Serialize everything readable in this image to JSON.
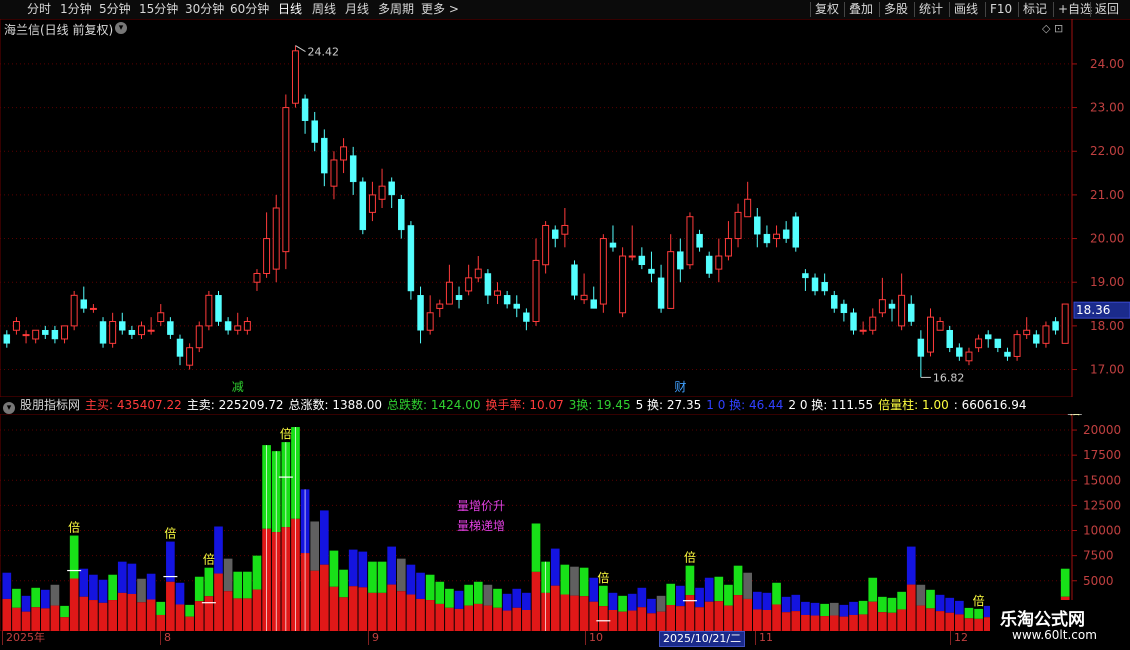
{
  "toolbar": {
    "left_items": [
      "分时",
      "1分钟",
      "5分钟",
      "15分钟",
      "30分钟",
      "60分钟",
      "日线",
      "周线",
      "月线",
      "多周期",
      "更多 >"
    ],
    "active": "日线",
    "right_items": [
      "复权",
      "叠加",
      "多股",
      "统计",
      "画线",
      "F10",
      "标记",
      "+自选",
      "返回"
    ]
  },
  "main_chart": {
    "title": "海兰信(日线 前复权)",
    "icons": [
      "◇",
      "⊡"
    ],
    "price_ticks": [
      "24.00",
      "23.00",
      "22.00",
      "21.00",
      "20.00",
      "19.00",
      "18.00",
      "17.00"
    ],
    "last_price": "18.36",
    "high_label": "24.42",
    "low_label": "16.82",
    "markers": [
      {
        "text": "减",
        "color": "#30d030"
      },
      {
        "text": "财",
        "color": "#40a0ff"
      }
    ]
  },
  "indicator": {
    "name": "股朋指标网",
    "fields": [
      {
        "text": "主买: 435407.22",
        "color": "#ff3b3b"
      },
      {
        "text": "主卖: 225209.72",
        "color": "#ffffff"
      },
      {
        "text": "总涨数: 1388.00",
        "color": "#ffffff"
      },
      {
        "text": "总跌数: 1424.00",
        "color": "#30d030"
      },
      {
        "text": "换手率: 10.07",
        "color": "#ff3b3b"
      },
      {
        "text": "3换: 19.45",
        "color": "#30d030"
      },
      {
        "text": "5 换: 27.35",
        "color": "#ffffff"
      },
      {
        "text": "1 0 换: 46.44",
        "color": "#3040ff"
      },
      {
        "text": "2 0 换: 111.55",
        "color": "#ffffff"
      },
      {
        "text": "倍量柱: 1.00",
        "color": "#ffff40"
      },
      {
        "text": ": 660616.94",
        "color": "#ffffff"
      }
    ],
    "vol_ticks": [
      "20000",
      "17500",
      "15000",
      "12500",
      "10000",
      "7500",
      "5000"
    ],
    "annotations": [
      "量增价升",
      "量梯递增"
    ],
    "bei_label": "倍"
  },
  "dates": [
    "2025年",
    "8",
    "9",
    "10",
    "2025/10/21/二",
    "11",
    "12"
  ],
  "watermark": {
    "title": "乐淘公式网",
    "url": "www.60lt.com"
  },
  "chart_data": {
    "type": "candlestick",
    "ylim": [
      16.6,
      24.8
    ],
    "vol_ylim": [
      0,
      21000
    ],
    "candles": [
      [
        17.8,
        17.6,
        17.9,
        17.5
      ],
      [
        17.9,
        18.1,
        18.2,
        17.8
      ],
      [
        17.8,
        17.8,
        17.9,
        17.6
      ],
      [
        17.7,
        17.9,
        17.9,
        17.6
      ],
      [
        17.9,
        17.8,
        18.0,
        17.7
      ],
      [
        17.9,
        17.7,
        18.0,
        17.6
      ],
      [
        17.7,
        18.0,
        18.0,
        17.6
      ],
      [
        18.0,
        18.7,
        18.8,
        17.9
      ],
      [
        18.6,
        18.4,
        18.9,
        18.3
      ],
      [
        18.4,
        18.4,
        18.5,
        18.3
      ],
      [
        18.1,
        17.6,
        18.2,
        17.5
      ],
      [
        17.6,
        18.1,
        18.3,
        17.5
      ],
      [
        18.1,
        17.9,
        18.3,
        17.8
      ],
      [
        17.9,
        17.8,
        18.0,
        17.7
      ],
      [
        17.8,
        18.0,
        18.1,
        17.7
      ],
      [
        17.9,
        17.9,
        18.2,
        17.8
      ],
      [
        18.1,
        18.3,
        18.5,
        18.0
      ],
      [
        18.1,
        17.8,
        18.2,
        17.7
      ],
      [
        17.7,
        17.3,
        17.8,
        17.1
      ],
      [
        17.1,
        17.5,
        17.6,
        17.0
      ],
      [
        17.5,
        18.0,
        18.1,
        17.4
      ],
      [
        18.0,
        18.7,
        18.8,
        17.9
      ],
      [
        18.7,
        18.1,
        18.8,
        18.0
      ],
      [
        18.1,
        17.9,
        18.2,
        17.8
      ],
      [
        17.9,
        18.0,
        18.3,
        17.8
      ],
      [
        17.9,
        18.1,
        18.2,
        17.8
      ],
      [
        19.0,
        19.2,
        19.3,
        18.8
      ],
      [
        19.2,
        20.0,
        20.6,
        19.1
      ],
      [
        19.3,
        20.7,
        21.0,
        19.0
      ],
      [
        19.7,
        23.0,
        23.3,
        19.3
      ],
      [
        23.1,
        24.3,
        24.42,
        23.0
      ],
      [
        23.2,
        22.7,
        23.3,
        22.4
      ],
      [
        22.7,
        22.2,
        22.9,
        22.0
      ],
      [
        22.3,
        21.5,
        22.5,
        21.2
      ],
      [
        21.2,
        21.8,
        22.0,
        20.9
      ],
      [
        21.8,
        22.1,
        22.3,
        21.5
      ],
      [
        21.9,
        21.3,
        22.1,
        21.0
      ],
      [
        21.3,
        20.2,
        21.4,
        20.1
      ],
      [
        20.6,
        21.0,
        21.3,
        20.4
      ],
      [
        20.9,
        21.2,
        21.6,
        20.7
      ],
      [
        21.3,
        21.0,
        21.4,
        20.7
      ],
      [
        20.9,
        20.2,
        21.0,
        20.0
      ],
      [
        20.3,
        18.8,
        20.4,
        18.6
      ],
      [
        18.7,
        17.9,
        18.9,
        17.6
      ],
      [
        17.9,
        18.3,
        18.7,
        17.8
      ],
      [
        18.4,
        18.5,
        18.6,
        18.2
      ],
      [
        18.5,
        19.0,
        19.4,
        18.5
      ],
      [
        18.7,
        18.6,
        18.9,
        18.4
      ],
      [
        18.8,
        19.1,
        19.4,
        18.7
      ],
      [
        19.1,
        19.3,
        19.6,
        19.0
      ],
      [
        19.2,
        18.7,
        19.3,
        18.5
      ],
      [
        18.7,
        18.8,
        19.0,
        18.5
      ],
      [
        18.7,
        18.5,
        18.8,
        18.4
      ],
      [
        18.5,
        18.4,
        18.7,
        18.2
      ],
      [
        18.3,
        18.1,
        18.4,
        17.9
      ],
      [
        18.1,
        19.5,
        20.0,
        18.0
      ],
      [
        19.4,
        20.3,
        20.4,
        19.2
      ],
      [
        20.2,
        20.0,
        20.3,
        19.8
      ],
      [
        20.1,
        20.3,
        20.7,
        19.8
      ],
      [
        19.4,
        18.7,
        19.5,
        18.6
      ],
      [
        18.6,
        18.7,
        19.2,
        18.5
      ],
      [
        18.6,
        18.4,
        18.9,
        18.4
      ],
      [
        18.5,
        20.0,
        20.1,
        18.3
      ],
      [
        19.9,
        19.8,
        20.3,
        19.7
      ],
      [
        18.3,
        19.6,
        19.8,
        18.2
      ],
      [
        19.6,
        19.6,
        20.3,
        19.5
      ],
      [
        19.6,
        19.4,
        19.8,
        19.3
      ],
      [
        19.3,
        19.2,
        19.7,
        19.0
      ],
      [
        19.1,
        18.4,
        19.4,
        18.3
      ],
      [
        18.4,
        19.7,
        20.1,
        18.5
      ],
      [
        19.7,
        19.3,
        20.0,
        19.0
      ],
      [
        19.4,
        20.5,
        20.6,
        19.3
      ],
      [
        20.1,
        19.8,
        20.2,
        19.7
      ],
      [
        19.6,
        19.2,
        19.7,
        19.1
      ],
      [
        19.3,
        19.6,
        20.0,
        19.0
      ],
      [
        19.6,
        20.0,
        20.4,
        19.5
      ],
      [
        20.0,
        20.6,
        20.8,
        19.8
      ],
      [
        20.5,
        20.9,
        21.3,
        20.5
      ],
      [
        20.5,
        20.1,
        20.7,
        19.8
      ],
      [
        20.1,
        19.9,
        20.3,
        19.8
      ],
      [
        20.0,
        20.1,
        20.3,
        19.8
      ],
      [
        20.2,
        20.0,
        20.4,
        19.9
      ],
      [
        20.5,
        19.8,
        20.6,
        19.7
      ],
      [
        19.2,
        19.1,
        19.3,
        18.8
      ],
      [
        19.1,
        18.8,
        19.2,
        18.7
      ],
      [
        19.0,
        18.8,
        19.2,
        18.7
      ],
      [
        18.7,
        18.4,
        18.8,
        18.3
      ],
      [
        18.5,
        18.3,
        18.6,
        18.1
      ],
      [
        18.3,
        17.9,
        18.4,
        17.8
      ],
      [
        17.9,
        17.9,
        18.1,
        17.8
      ],
      [
        17.9,
        18.2,
        18.4,
        17.8
      ],
      [
        18.3,
        18.6,
        19.1,
        18.2
      ],
      [
        18.5,
        18.4,
        18.6,
        18.1
      ],
      [
        18.0,
        18.7,
        19.2,
        17.9
      ],
      [
        18.5,
        18.1,
        18.7,
        18.0
      ],
      [
        17.7,
        17.3,
        17.9,
        16.82
      ],
      [
        17.4,
        18.2,
        18.4,
        17.3
      ],
      [
        17.9,
        18.1,
        18.2,
        17.9
      ],
      [
        17.9,
        17.5,
        18.0,
        17.4
      ],
      [
        17.5,
        17.3,
        17.6,
        17.2
      ],
      [
        17.2,
        17.4,
        17.5,
        17.1
      ],
      [
        17.5,
        17.7,
        17.8,
        17.4
      ],
      [
        17.8,
        17.7,
        17.9,
        17.5
      ],
      [
        17.7,
        17.5,
        17.7,
        17.4
      ],
      [
        17.4,
        17.3,
        17.5,
        17.2
      ],
      [
        17.3,
        17.8,
        17.9,
        17.2
      ],
      [
        17.8,
        17.9,
        18.2,
        17.7
      ],
      [
        17.8,
        17.6,
        17.9,
        17.5
      ],
      [
        17.6,
        18.0,
        18.1,
        17.5
      ],
      [
        18.1,
        17.9,
        18.2,
        17.8
      ],
      [
        17.6,
        18.5,
        18.5,
        17.6
      ]
    ],
    "volume": [
      5800,
      4200,
      3500,
      4300,
      4100,
      4600,
      2500,
      9500,
      6200,
      5600,
      5100,
      5600,
      6900,
      6700,
      5200,
      5700,
      2900,
      8900,
      4800,
      2600,
      5400,
      6300,
      10400,
      7200,
      5900,
      5900,
      7500,
      18500,
      17900,
      18800,
      20300,
      14100,
      10900,
      12000,
      8000,
      6100,
      8100,
      7900,
      6900,
      6900,
      8400,
      7200,
      6600,
      5800,
      5600,
      4900,
      4200,
      4000,
      4600,
      4900,
      4600,
      4200,
      3700,
      4200,
      3800,
      10700,
      6900,
      8200,
      6600,
      6400,
      6300,
      5300,
      4500,
      3800,
      3500,
      3700,
      4300,
      3200,
      3500,
      4700,
      4500,
      6500,
      4300,
      5300,
      5400,
      4600,
      6500,
      5800,
      3900,
      3800,
      4800,
      3400,
      3600,
      2900,
      2800,
      2700,
      2800,
      2600,
      2900,
      3000,
      5300,
      3400,
      3300,
      3900,
      8400,
      4600,
      4100,
      3600,
      3300,
      3000,
      2300,
      2200,
      2500,
      2400,
      2300,
      2000,
      2400,
      2300,
      2500,
      2300,
      6200
    ],
    "increase_flags": [
      0,
      1,
      0,
      1,
      0,
      0,
      1,
      1,
      0,
      0,
      0,
      1,
      0,
      0,
      1,
      0,
      1,
      0,
      0,
      1,
      1,
      1,
      0,
      0,
      1,
      1,
      1,
      1,
      1,
      1,
      1,
      0,
      0,
      0,
      1,
      1,
      0,
      0,
      1,
      1,
      0,
      0,
      0,
      0,
      1,
      1,
      1,
      0,
      1,
      1,
      0,
      1,
      0,
      0,
      0,
      1,
      1,
      0,
      1,
      0,
      1,
      0,
      1,
      0,
      1,
      0,
      0,
      0,
      0,
      1,
      0,
      1,
      0,
      0,
      1,
      1,
      1,
      1,
      0,
      0,
      1,
      0,
      0,
      0,
      0,
      1,
      0,
      0,
      0,
      1,
      1,
      1,
      1,
      1,
      0,
      0,
      1,
      0,
      0,
      0,
      1,
      1,
      0,
      0,
      0,
      1,
      1,
      0,
      1,
      0,
      1
    ],
    "bei_positions": [
      7,
      17,
      21,
      29,
      62,
      71,
      101,
      111
    ]
  }
}
